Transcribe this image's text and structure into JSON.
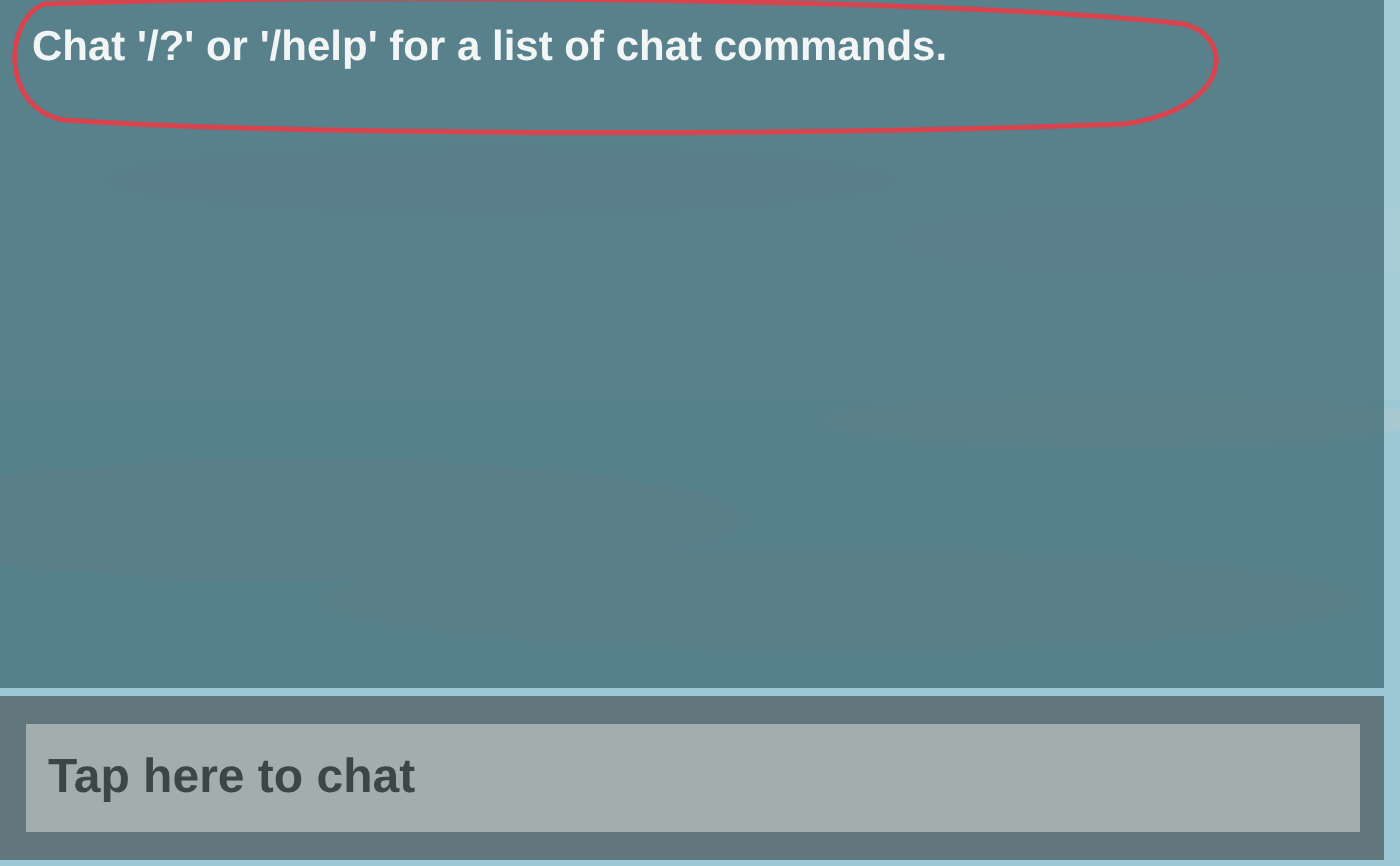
{
  "chat_log": {
    "messages": [
      {
        "text": "Chat '/?' or '/help' for a list of chat commands.",
        "circled": true
      }
    ]
  },
  "chat_bar": {
    "placeholder": "Tap here to chat"
  }
}
